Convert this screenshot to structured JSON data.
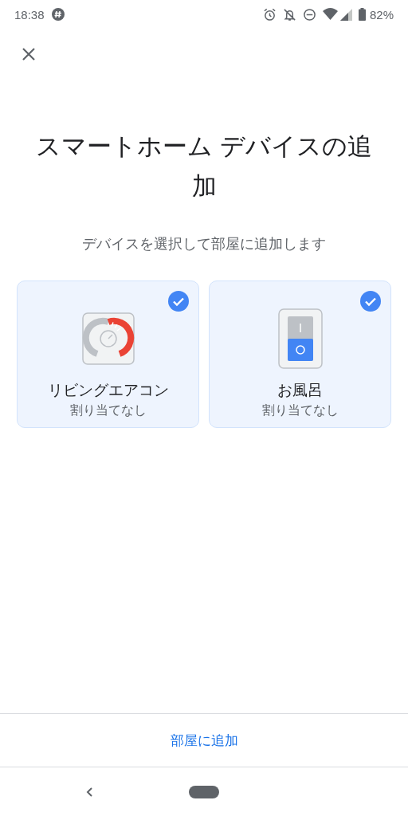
{
  "status_bar": {
    "time": "18:38",
    "battery": "82%"
  },
  "title": "スマートホーム デバイスの追加",
  "subtitle": "デバイスを選択して部屋に追加します",
  "devices": [
    {
      "kind": "thermostat",
      "name": "リビングエアコン",
      "room": "割り当てなし",
      "selected": true
    },
    {
      "kind": "switch",
      "name": "お風呂",
      "room": "割り当てなし",
      "selected": true
    }
  ],
  "action_button": "部屋に追加"
}
